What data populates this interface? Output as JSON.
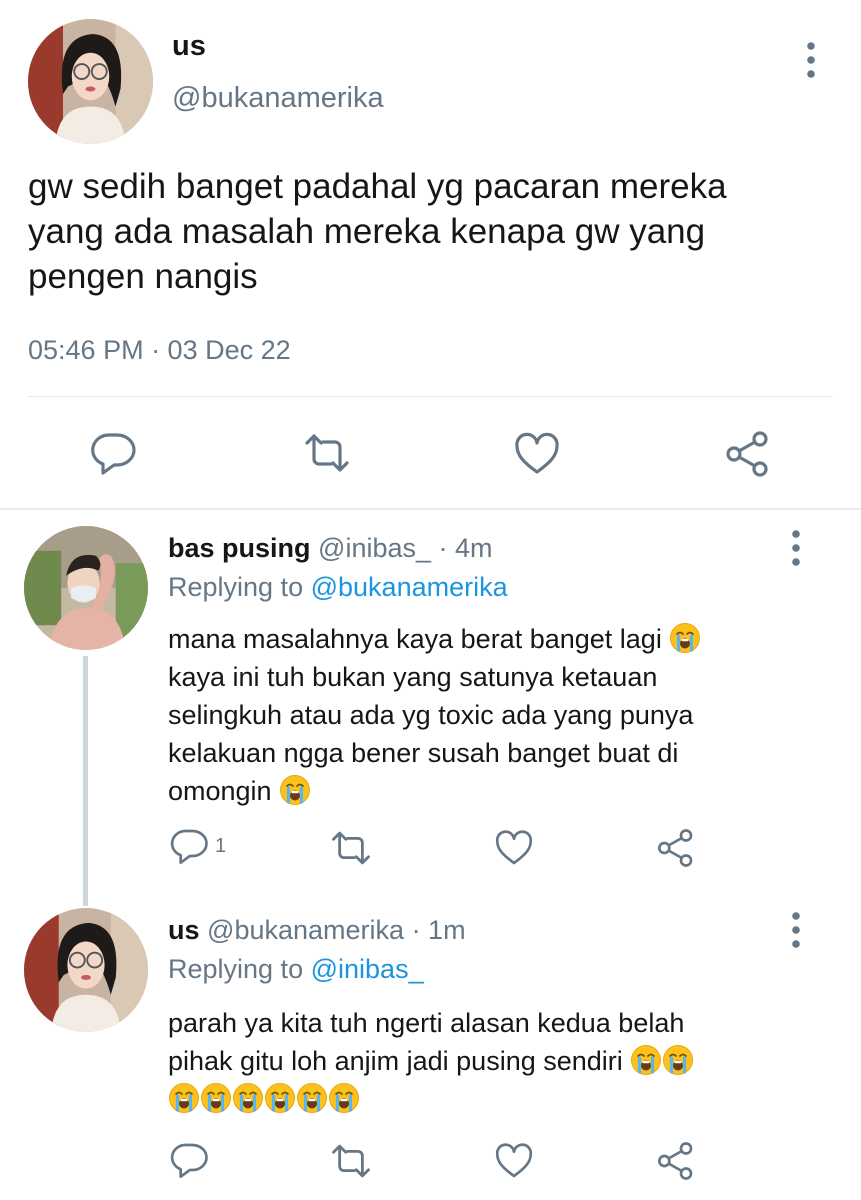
{
  "main_tweet": {
    "display_name": "us",
    "handle": "@bukanamerika",
    "text_lines": [
      "gw sedih banget padahal yg pacaran mereka",
      "yang ada masalah mereka kenapa gw yang",
      "pengen nangis"
    ],
    "timestamp": "05:46 PM · 03 Dec 22"
  },
  "reply1": {
    "display_name": "bas pusing",
    "handle": "@inibas_",
    "time": "· 4m",
    "replying_prefix": "Replying to",
    "replying_to": "@bukanamerika",
    "text_lines": [
      "mana masalahnya kaya berat banget lagi",
      "kaya ini tuh bukan yang satunya ketauan",
      "selingkuh atau ada yg toxic ada yang punya",
      "kelakuan ngga bener susah banget buat di",
      "omongin"
    ],
    "reply_count": "1"
  },
  "reply2": {
    "display_name": "us",
    "handle": "@bukanamerika",
    "time": "· 1m",
    "replying_prefix": "Replying to",
    "replying_to": "@inibas_",
    "text_lines": [
      "parah ya kita tuh ngerti alasan kedua belah",
      "pihak gitu loh anjim jadi pusing sendiri"
    ]
  },
  "icons": {
    "reply": "speech-bubble-icon",
    "retweet": "retweet-icon",
    "like": "heart-icon",
    "share": "share-icon",
    "more": "vertical-dots-icon",
    "emoji": "loudly-crying-face-emoji"
  },
  "colors": {
    "text": "#14171a",
    "secondary": "#657786",
    "link": "#1b95e0",
    "divider": "#e1e8ed",
    "thread_line": "#ccd6dd"
  }
}
